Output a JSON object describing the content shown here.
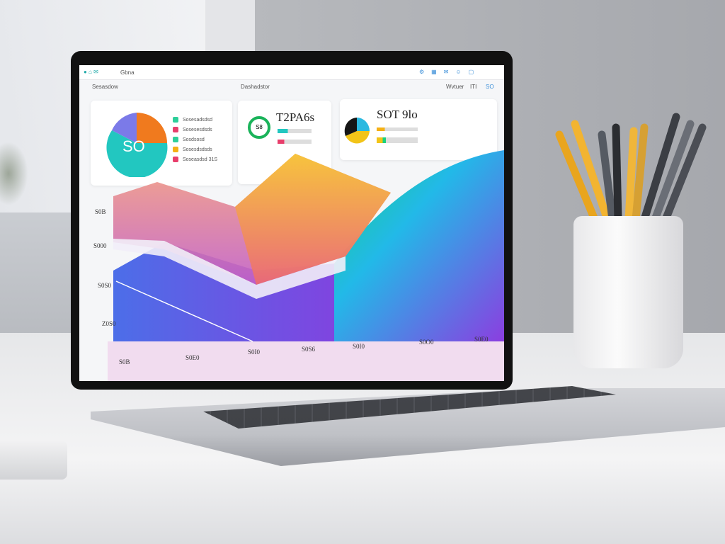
{
  "scene": "laptop on desk with pencil cup",
  "dashboard": {
    "app_title": "Gbna",
    "topbar_icons": [
      "settings-icon",
      "grid-icon",
      "chat-icon",
      "user-icon"
    ],
    "breadcrumb": "Sesasdow",
    "section_label": "Dashadstor",
    "right_labels": [
      "Wvtuer",
      "ITI",
      "SO"
    ],
    "pie_card": {
      "center": "SO",
      "legend": [
        "Sosesadsdsd",
        "Sosesesdsds",
        "Sosdsosd",
        "Sosesdsdsds",
        "Soseasdsd 31S"
      ],
      "colors": [
        "#2ecf9a",
        "#e83e6b",
        "#2ecf9a",
        "#f5b014",
        "#e83e6b"
      ]
    },
    "ring_card": {
      "title": "T2PA6s",
      "ring_label": "S8"
    },
    "pie2_card": {
      "title": "SOT 9lo"
    },
    "area_chart": {
      "y_labels": [
        "S0B",
        "S000",
        "S0S0",
        "Z0S0"
      ],
      "x_labels": [
        "S0B",
        "S0E0",
        "S0I0",
        "S0S6",
        "S0I0",
        "S0O0",
        "S0E0"
      ]
    }
  },
  "colors": {
    "accent_teal": "#22c7c0",
    "accent_orange": "#f07a1e",
    "accent_purple": "#7b4ae8",
    "accent_green": "#19d17d"
  }
}
